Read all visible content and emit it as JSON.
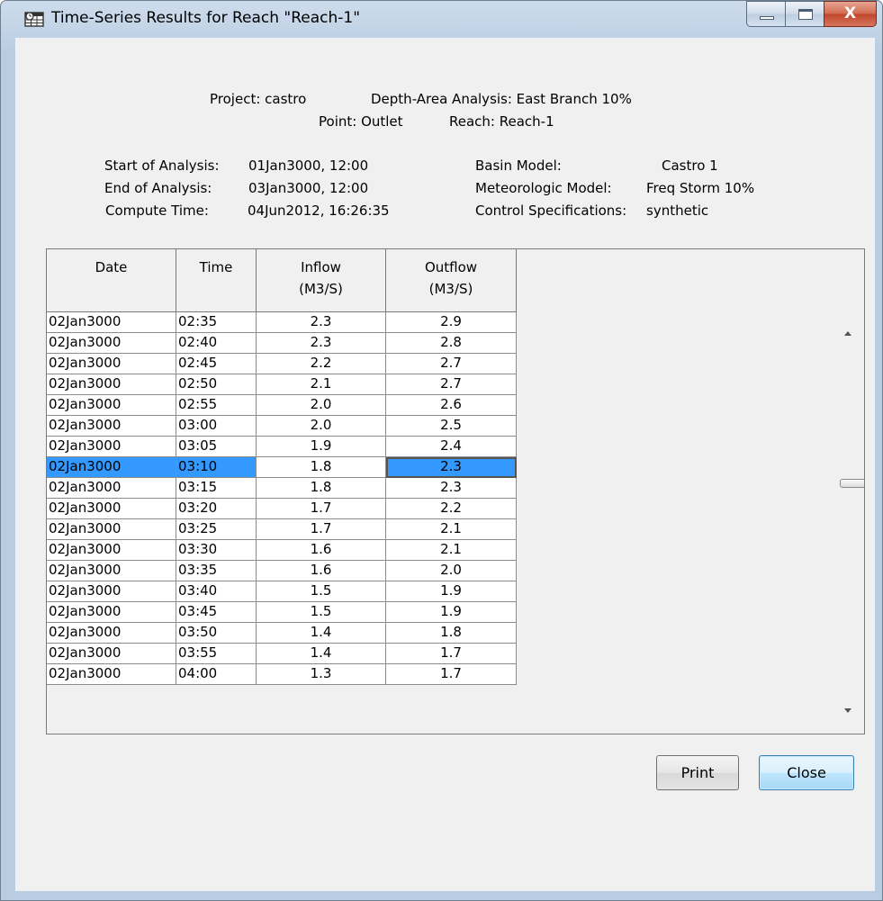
{
  "window": {
    "title": "Time-Series Results for Reach \"Reach-1\"",
    "icon": "calendar-grid-icon",
    "controls": {
      "minimize": "minimize-icon",
      "maximize": "maximize-icon",
      "close_label": "X"
    }
  },
  "header": {
    "project": "Project: castro",
    "analysis": "Depth-Area Analysis: East Branch 10%",
    "point": "Point: Outlet",
    "reach": "Reach: Reach-1"
  },
  "details": {
    "start_label": "Start of Analysis:",
    "start_value": "01Jan3000, 12:00",
    "end_label": "End of Analysis:",
    "end_value": "03Jan3000, 12:00",
    "compute_label": "Compute Time:",
    "compute_value": "04Jun2012, 16:26:35",
    "basin_label": "Basin Model:",
    "basin_value": "Castro 1",
    "met_label": "Meteorologic Model:",
    "met_value": "Freq Storm 10%",
    "control_label": "Control Specifications:",
    "control_value": "synthetic"
  },
  "table": {
    "columns": [
      {
        "line1": "Date",
        "line2": ""
      },
      {
        "line1": "Time",
        "line2": ""
      },
      {
        "line1": "Inflow",
        "line2": "(M3/S)"
      },
      {
        "line1": "Outflow",
        "line2": "(M3/S)"
      }
    ],
    "selected_row": 7,
    "rows": [
      [
        "02Jan3000",
        "02:35",
        "2.3",
        "2.9"
      ],
      [
        "02Jan3000",
        "02:40",
        "2.3",
        "2.8"
      ],
      [
        "02Jan3000",
        "02:45",
        "2.2",
        "2.7"
      ],
      [
        "02Jan3000",
        "02:50",
        "2.1",
        "2.7"
      ],
      [
        "02Jan3000",
        "02:55",
        "2.0",
        "2.6"
      ],
      [
        "02Jan3000",
        "03:00",
        "2.0",
        "2.5"
      ],
      [
        "02Jan3000",
        "03:05",
        "1.9",
        "2.4"
      ],
      [
        "02Jan3000",
        "03:10",
        "1.8",
        "2.3"
      ],
      [
        "02Jan3000",
        "03:15",
        "1.8",
        "2.3"
      ],
      [
        "02Jan3000",
        "03:20",
        "1.7",
        "2.2"
      ],
      [
        "02Jan3000",
        "03:25",
        "1.7",
        "2.1"
      ],
      [
        "02Jan3000",
        "03:30",
        "1.6",
        "2.1"
      ],
      [
        "02Jan3000",
        "03:35",
        "1.6",
        "2.0"
      ],
      [
        "02Jan3000",
        "03:40",
        "1.5",
        "1.9"
      ],
      [
        "02Jan3000",
        "03:45",
        "1.5",
        "1.9"
      ],
      [
        "02Jan3000",
        "03:50",
        "1.4",
        "1.8"
      ],
      [
        "02Jan3000",
        "03:55",
        "1.4",
        "1.7"
      ],
      [
        "02Jan3000",
        "04:00",
        "1.3",
        "1.7"
      ]
    ]
  },
  "buttons": {
    "print": "Print",
    "close": "Close"
  },
  "colors": {
    "selection": "#3399ff",
    "dialog_bg": "#f0f0f0"
  }
}
